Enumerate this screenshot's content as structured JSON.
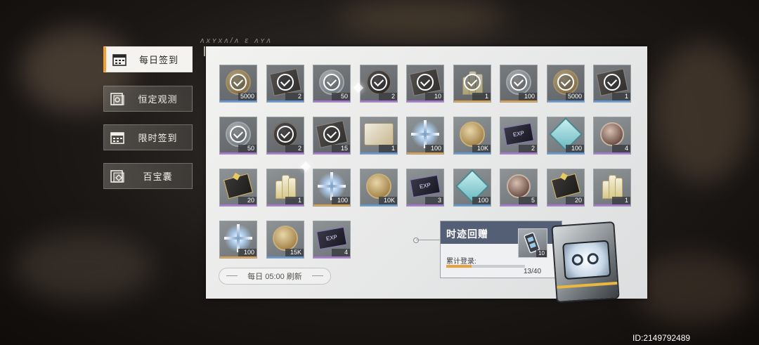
{
  "sidebar": {
    "tabs": [
      {
        "label": "每日签到",
        "active": true,
        "icon": "calendar-icon"
      },
      {
        "label": "恒定观测",
        "active": false,
        "icon": "observe-card-icon"
      },
      {
        "label": "限时签到",
        "active": false,
        "icon": "calendar-icon"
      },
      {
        "label": "百宝囊",
        "active": false,
        "icon": "treasure-bag-icon"
      }
    ]
  },
  "rewards": [
    {
      "icon": "gold-coin",
      "qty": "5000",
      "rarity": "blue",
      "claimed": true
    },
    {
      "icon": "dark-case",
      "qty": "2",
      "rarity": "blue",
      "claimed": true
    },
    {
      "icon": "silver-coin",
      "qty": "50",
      "rarity": "purple",
      "claimed": true
    },
    {
      "icon": "dark-coin",
      "qty": "2",
      "rarity": "purple",
      "claimed": true
    },
    {
      "icon": "dark-case",
      "qty": "10",
      "rarity": "purple",
      "claimed": true
    },
    {
      "icon": "vials",
      "qty": "1",
      "rarity": "gold",
      "claimed": true
    },
    {
      "icon": "silver-coin",
      "qty": "100",
      "rarity": "gold",
      "claimed": true
    },
    {
      "icon": "gold-coin",
      "qty": "5000",
      "rarity": "blue",
      "claimed": true
    },
    {
      "icon": "dark-case",
      "qty": "1",
      "rarity": "blue",
      "claimed": true
    },
    {
      "icon": "silver-coin",
      "qty": "50",
      "rarity": "purple",
      "claimed": true
    },
    {
      "icon": "dark-coin",
      "qty": "2",
      "rarity": "purple",
      "claimed": true
    },
    {
      "icon": "dark-case",
      "qty": "15",
      "rarity": "purple",
      "claimed": true
    },
    {
      "icon": "device",
      "qty": "1",
      "rarity": "blue",
      "claimed": false
    },
    {
      "icon": "star",
      "qty": "100",
      "rarity": "gold",
      "claimed": false
    },
    {
      "icon": "gold-coin",
      "qty": "10K",
      "rarity": "blue",
      "claimed": false
    },
    {
      "icon": "exp",
      "qty": "2",
      "rarity": "purple",
      "claimed": false
    },
    {
      "icon": "gem",
      "qty": "100",
      "rarity": "blue",
      "claimed": false
    },
    {
      "icon": "feather",
      "qty": "4",
      "rarity": "purple",
      "claimed": false
    },
    {
      "icon": "giftbox",
      "qty": "20",
      "rarity": "purple",
      "claimed": false
    },
    {
      "icon": "vials",
      "qty": "1",
      "rarity": "purple",
      "claimed": false
    },
    {
      "icon": "star",
      "qty": "100",
      "rarity": "gold",
      "claimed": false
    },
    {
      "icon": "gold-coin",
      "qty": "10K",
      "rarity": "blue",
      "claimed": false
    },
    {
      "icon": "exp",
      "qty": "3",
      "rarity": "purple",
      "claimed": false
    },
    {
      "icon": "gem",
      "qty": "100",
      "rarity": "blue",
      "claimed": false
    },
    {
      "icon": "feather",
      "qty": "5",
      "rarity": "purple",
      "claimed": false
    },
    {
      "icon": "giftbox",
      "qty": "20",
      "rarity": "purple",
      "claimed": false
    },
    {
      "icon": "vials",
      "qty": "1",
      "rarity": "purple",
      "claimed": false
    },
    {
      "icon": "star",
      "qty": "100",
      "rarity": "gold",
      "claimed": false
    },
    {
      "icon": "gold-coin",
      "qty": "15K",
      "rarity": "blue",
      "claimed": false
    },
    {
      "icon": "exp",
      "qty": "4",
      "rarity": "purple",
      "claimed": false
    }
  ],
  "rarity_colors": {
    "blue": "#5a9ae0",
    "purple": "#b070e0",
    "gold": "#e8a040"
  },
  "refresh": {
    "text": "每日 05:00  刷新"
  },
  "footprint_gift": {
    "title": "时迹回赠",
    "label": "累计登录:",
    "count_text": "13/40",
    "progress": 0.325,
    "reward_qty": "10",
    "reward_icon": "case-icon"
  },
  "watermark": "ID:2149792489",
  "accent_color": "#f0a030"
}
